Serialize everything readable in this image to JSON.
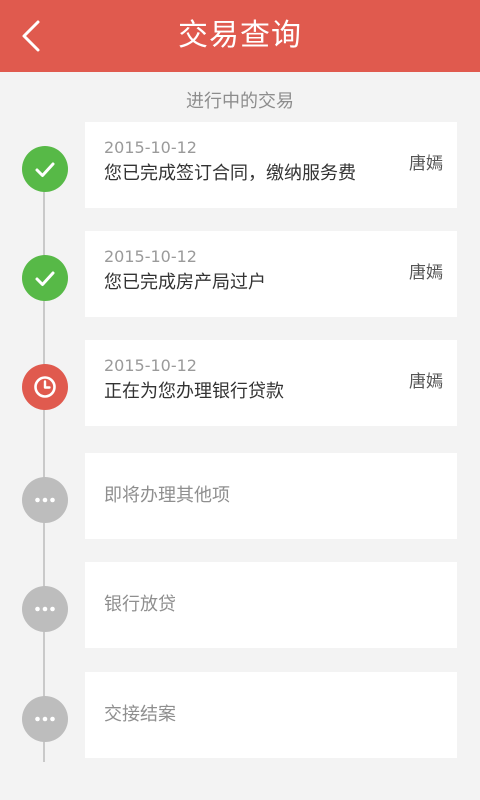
{
  "header": {
    "title": "交易查询",
    "back_icon": "chevron-left-icon",
    "bg_color": "#e05a4e"
  },
  "section": {
    "title": "进行中的交易"
  },
  "steps": [
    {
      "status": "done",
      "icon": "check-icon",
      "date": "2015-10-12",
      "text": "您已完成签订合同，缴纳服务费",
      "person": "唐嫣"
    },
    {
      "status": "done",
      "icon": "check-icon",
      "date": "2015-10-12",
      "text": "您已完成房产局过户",
      "person": "唐嫣"
    },
    {
      "status": "active",
      "icon": "clock-icon",
      "date": "2015-10-12",
      "text": "正在为您办理银行贷款",
      "person": "唐嫣"
    },
    {
      "status": "pending",
      "icon": "ellipsis-icon",
      "text": "即将办理其他项"
    },
    {
      "status": "pending",
      "icon": "ellipsis-icon",
      "text": "银行放贷"
    },
    {
      "status": "pending",
      "icon": "ellipsis-icon",
      "text": "交接结案"
    }
  ],
  "colors": {
    "done": "#57b947",
    "active": "#e05a4e",
    "pending": "#bdbdbd"
  }
}
